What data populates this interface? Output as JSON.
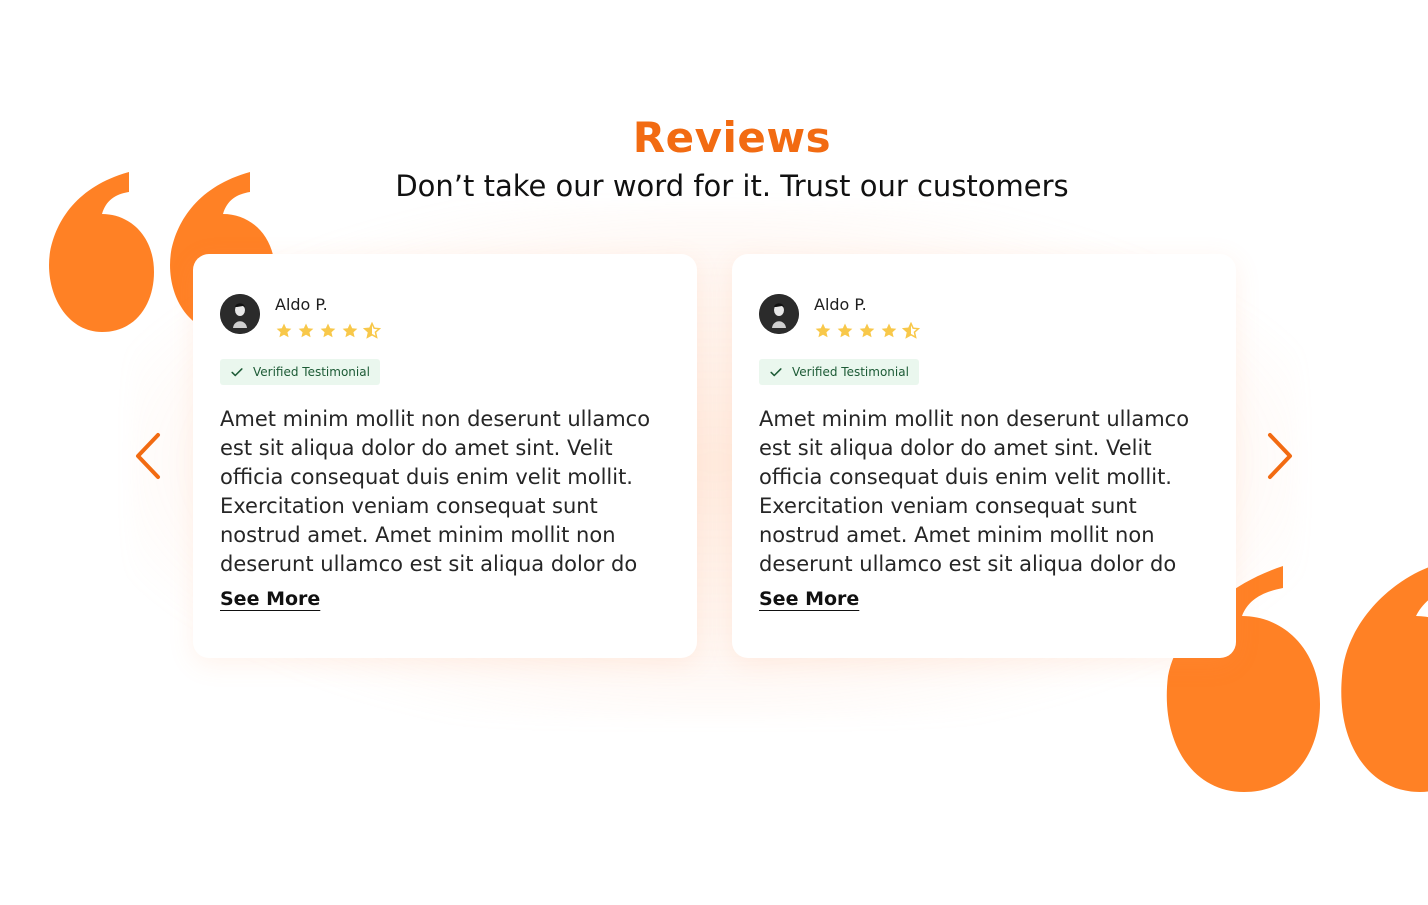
{
  "header": {
    "title": "Reviews",
    "subtitle": "Don’t take our word for it. Trust our customers"
  },
  "colors": {
    "accent": "#F26B12",
    "quote_mark": "#FF8125",
    "star": "#F8C84A",
    "badge_bg": "#EAF7EE",
    "badge_text": "#1D5B36"
  },
  "carousel": {
    "prev_icon": "chevron-left-icon",
    "next_icon": "chevron-right-icon"
  },
  "reviews": [
    {
      "author": "Aldo P.",
      "rating": 4.5,
      "rating_max": 5,
      "badge": "Verified Testimonial",
      "text": "Amet minim mollit non deserunt ullamco est sit aliqua dolor do amet sint. Velit officia consequat duis enim velit mollit. Exercitation veniam consequat sunt nostrud amet. Amet minim mollit non deserunt ullamco est sit aliqua dolor do",
      "see_more": "See More"
    },
    {
      "author": "Aldo P.",
      "rating": 4.5,
      "rating_max": 5,
      "badge": "Verified Testimonial",
      "text": "Amet minim mollit non deserunt ullamco est sit aliqua dolor do amet sint. Velit officia consequat duis enim velit mollit. Exercitation veniam consequat sunt nostrud amet. Amet minim mollit non deserunt ullamco est sit aliqua dolor do",
      "see_more": "See More"
    }
  ]
}
